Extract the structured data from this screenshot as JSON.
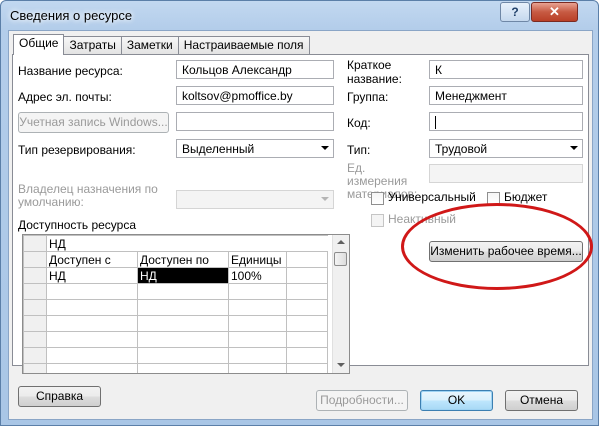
{
  "window": {
    "title": "Сведения о ресурсе",
    "help_glyph": "?",
    "close_glyph": "✕"
  },
  "tabs": [
    {
      "label": "Общие",
      "active": true
    },
    {
      "label": "Затраты",
      "active": false
    },
    {
      "label": "Заметки",
      "active": false
    },
    {
      "label": "Настраиваемые поля",
      "active": false
    }
  ],
  "general": {
    "resource_name_label": "Название ресурса:",
    "resource_name_value": "Кольцов Александр",
    "email_label": "Адрес эл. почты:",
    "email_value": "koltsov@pmoffice.by",
    "windows_account_button": "Учетная запись Windows...",
    "windows_account_value": "",
    "booking_type_label": "Тип резервирования:",
    "booking_type_value": "Выделенный",
    "default_assignment_owner_label": "Владелец назначения по умолчанию:",
    "default_assignment_owner_value": "",
    "short_name_label": "Краткое название:",
    "short_name_value": "К",
    "group_label": "Группа:",
    "group_value": "Менеджмент",
    "code_label": "Код:",
    "code_value": "",
    "type_label": "Тип:",
    "type_value": "Трудовой",
    "material_label": "Ед. измерения материалов:",
    "material_value": "",
    "generic_label": "Универсальный",
    "budget_label": "Бюджет",
    "inactive_label": "Неактивный",
    "change_working_time_button": "Изменить рабочее время...",
    "availability_label": "Доступность ресурса"
  },
  "availability_grid": {
    "edit_bar_value": "НД",
    "columns": [
      "Доступен с",
      "Доступен по",
      "Единицы"
    ],
    "rows": [
      [
        "НД",
        "НД",
        "100%"
      ]
    ]
  },
  "footer": {
    "help_button": "Справка",
    "details_button": "Подробности...",
    "ok_button": "OK",
    "cancel_button": "Отмена"
  },
  "colors": {
    "highlight_ellipse": "#d01818"
  }
}
